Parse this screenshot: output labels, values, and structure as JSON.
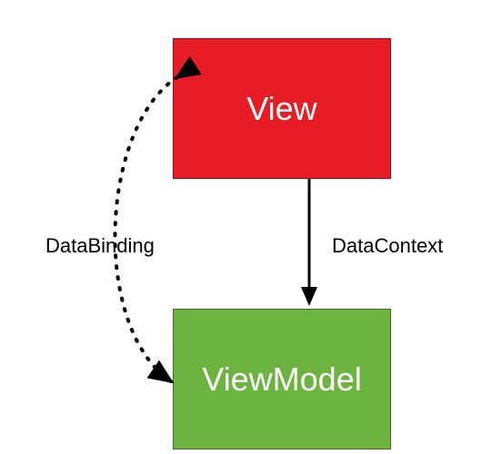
{
  "boxes": {
    "view": {
      "label": "View",
      "fill": "#e81c24",
      "border": "#8a1015"
    },
    "viewmodel": {
      "label": "ViewModel",
      "fill": "#6db33f",
      "border": "#3f6b25"
    }
  },
  "labels": {
    "databinding": "DataBinding",
    "datacontext": "DataContext"
  },
  "arrows": {
    "solid": {
      "stroke": "#000000",
      "width": 3
    },
    "dotted": {
      "stroke": "#000000",
      "width": 4,
      "dash": "2 8"
    }
  }
}
